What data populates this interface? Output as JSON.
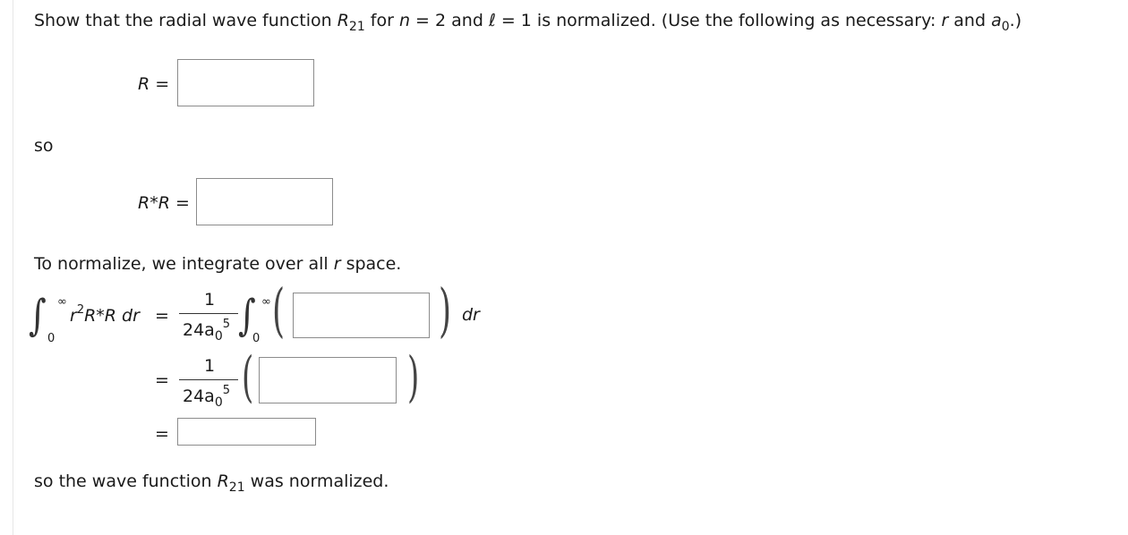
{
  "question": {
    "prefix": "Show that the radial wave function ",
    "R": "R",
    "R_sub": "21",
    "for": " for ",
    "n": "n",
    "n_eq": " = 2 and ",
    "ell": "ℓ",
    "ell_eq": " = 1 is normalized. (Use the following as necessary: ",
    "r": "r",
    "and": " and ",
    "a": "a",
    "a_sub": "0",
    "suffix": ".)"
  },
  "step1": {
    "lhs": "R",
    "eq": "=",
    "input_value": ""
  },
  "so_label": "so",
  "step2": {
    "lhs": "R*R",
    "eq": "=",
    "input_value": ""
  },
  "normalize_text": {
    "prefix": "To normalize, we integrate over all ",
    "r": "r",
    "suffix": " space."
  },
  "integral": {
    "symbol": "∫",
    "upper": "∞",
    "lower": "0",
    "r2": "r",
    "r2_exp": "2",
    "integrand_rest": "R*R dr",
    "eq": "=",
    "frac_num": "1",
    "frac_den": "24a",
    "frac_den_sub": "0",
    "frac_den_exp": "5",
    "dr": "dr",
    "lparen": "(",
    "rparen": ")",
    "input1_value": "",
    "input2_value": "",
    "input3_value": ""
  },
  "conclusion": {
    "prefix": "so the wave function ",
    "R": "R",
    "R_sub": "21",
    "suffix": " was normalized."
  }
}
